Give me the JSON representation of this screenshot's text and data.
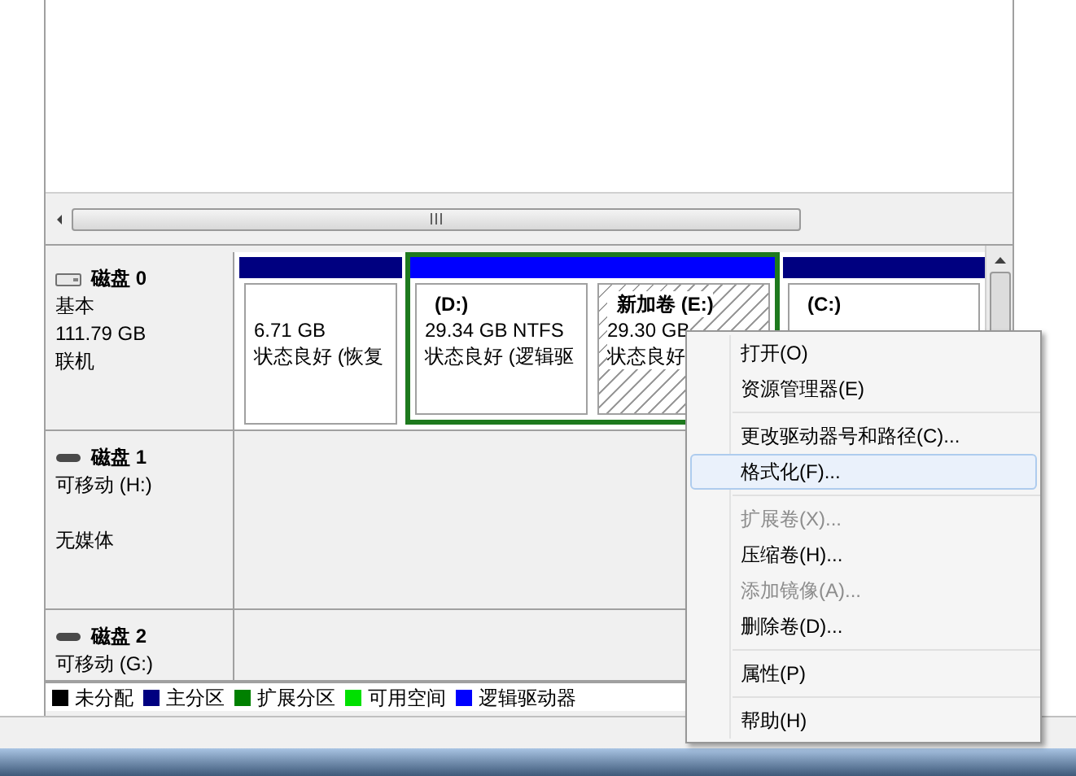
{
  "disks": [
    {
      "name": "磁盘 0",
      "kind": "fixed",
      "lines": [
        "基本",
        "111.79 GB",
        "联机"
      ],
      "partitions": [
        {
          "kind": "primary",
          "selected": false,
          "lines": [
            "6.71 GB",
            "状态良好 (恢复"
          ]
        },
        {
          "kind": "extended",
          "children": [
            {
              "kind": "logical",
              "selected": false,
              "title": "(D:)",
              "lines": [
                "29.34 GB NTFS",
                "状态良好 (逻辑驱"
              ]
            },
            {
              "kind": "logical",
              "selected": true,
              "title": "新加卷  (E:)",
              "lines": [
                "29.30 GB",
                "状态良好"
              ]
            }
          ]
        },
        {
          "kind": "primary",
          "selected": false,
          "title": "(C:)"
        }
      ]
    },
    {
      "name": "磁盘 1",
      "kind": "removable",
      "lines": [
        "可移动 (H:)"
      ],
      "status": "无媒体"
    },
    {
      "name": "磁盘 2",
      "kind": "removable",
      "lines": [
        "可移动 (G:)"
      ]
    }
  ],
  "legend": [
    {
      "label": "未分配",
      "color": "#000000"
    },
    {
      "label": "主分区",
      "color": "#000080"
    },
    {
      "label": "扩展分区",
      "color": "#008000"
    },
    {
      "label": "可用空间",
      "color": "#00e000"
    },
    {
      "label": "逻辑驱动器",
      "color": "#0000ff"
    }
  ],
  "context_menu": [
    {
      "kind": "item",
      "label": "打开(O)",
      "disabled": false,
      "selected": false
    },
    {
      "kind": "item",
      "label": "资源管理器(E)",
      "disabled": false,
      "selected": false
    },
    {
      "kind": "separator"
    },
    {
      "kind": "item",
      "label": "更改驱动器号和路径(C)...",
      "disabled": false,
      "selected": false
    },
    {
      "kind": "item",
      "label": "格式化(F)...",
      "disabled": false,
      "selected": true
    },
    {
      "kind": "separator"
    },
    {
      "kind": "item",
      "label": "扩展卷(X)...",
      "disabled": true,
      "selected": false
    },
    {
      "kind": "item",
      "label": "压缩卷(H)...",
      "disabled": false,
      "selected": false
    },
    {
      "kind": "item",
      "label": "添加镜像(A)...",
      "disabled": true,
      "selected": false
    },
    {
      "kind": "item",
      "label": "删除卷(D)...",
      "disabled": false,
      "selected": false
    },
    {
      "kind": "separator"
    },
    {
      "kind": "item",
      "label": "属性(P)",
      "disabled": false,
      "selected": false
    },
    {
      "kind": "separator"
    },
    {
      "kind": "item",
      "label": "帮助(H)",
      "disabled": false,
      "selected": false
    }
  ]
}
